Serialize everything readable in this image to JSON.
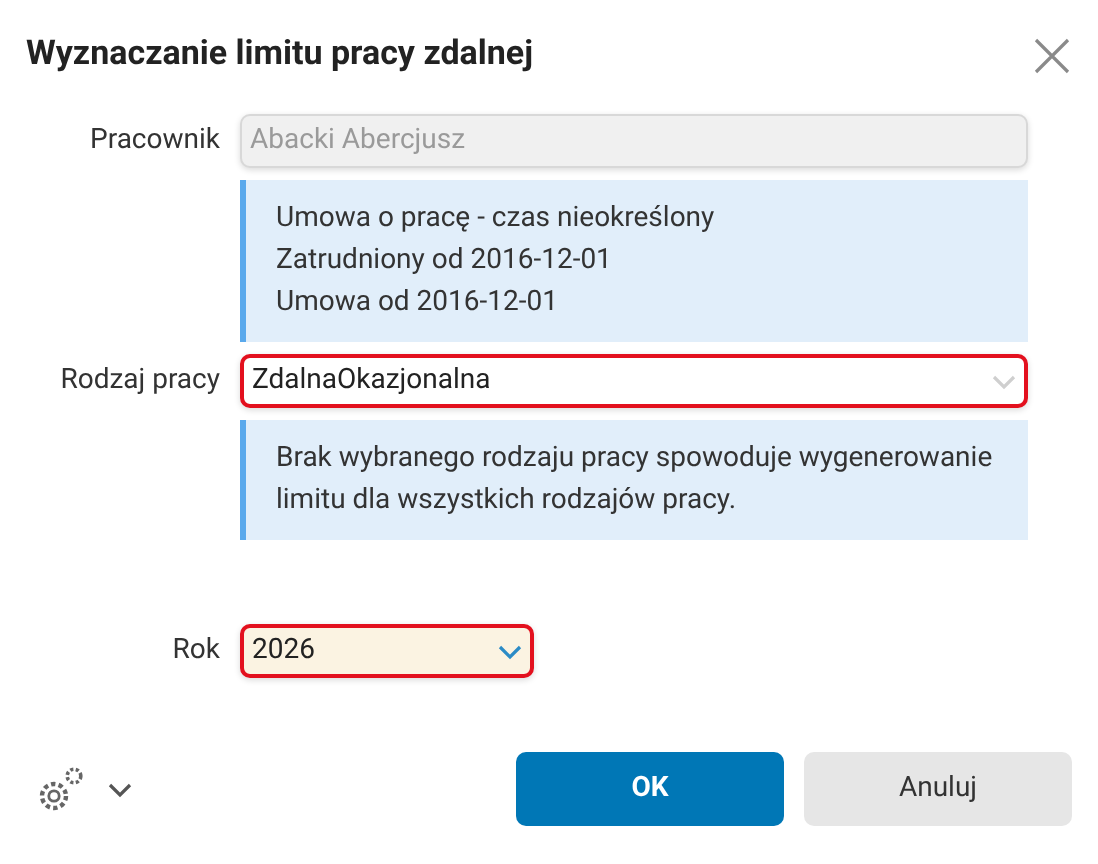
{
  "dialog": {
    "title": "Wyznaczanie limitu pracy zdalnej"
  },
  "fields": [
    {
      "kind": "text",
      "label": "Pracownik",
      "value": "Abacki Abercjusz",
      "disabled": true,
      "error": false,
      "info": [
        "Umowa o pracę - czas nieokreślony",
        "Zatrudniony od 2016-12-01",
        "Umowa od 2016-12-01"
      ]
    },
    {
      "kind": "select",
      "label": "Rodzaj pracy",
      "value": "ZdalnaOkazjonalna",
      "disabled": false,
      "error": true,
      "focused": false,
      "info": [
        "Brak wybranego rodzaju pracy spowoduje wygenerowanie limitu dla wszystkich rodzajów pracy."
      ]
    },
    {
      "kind": "select",
      "label": "Rok",
      "value": "2026",
      "disabled": false,
      "error": true,
      "focused": true
    }
  ],
  "buttons": [
    {
      "label": "OK",
      "primary": true
    },
    {
      "label": "Anuluj",
      "primary": false
    }
  ]
}
